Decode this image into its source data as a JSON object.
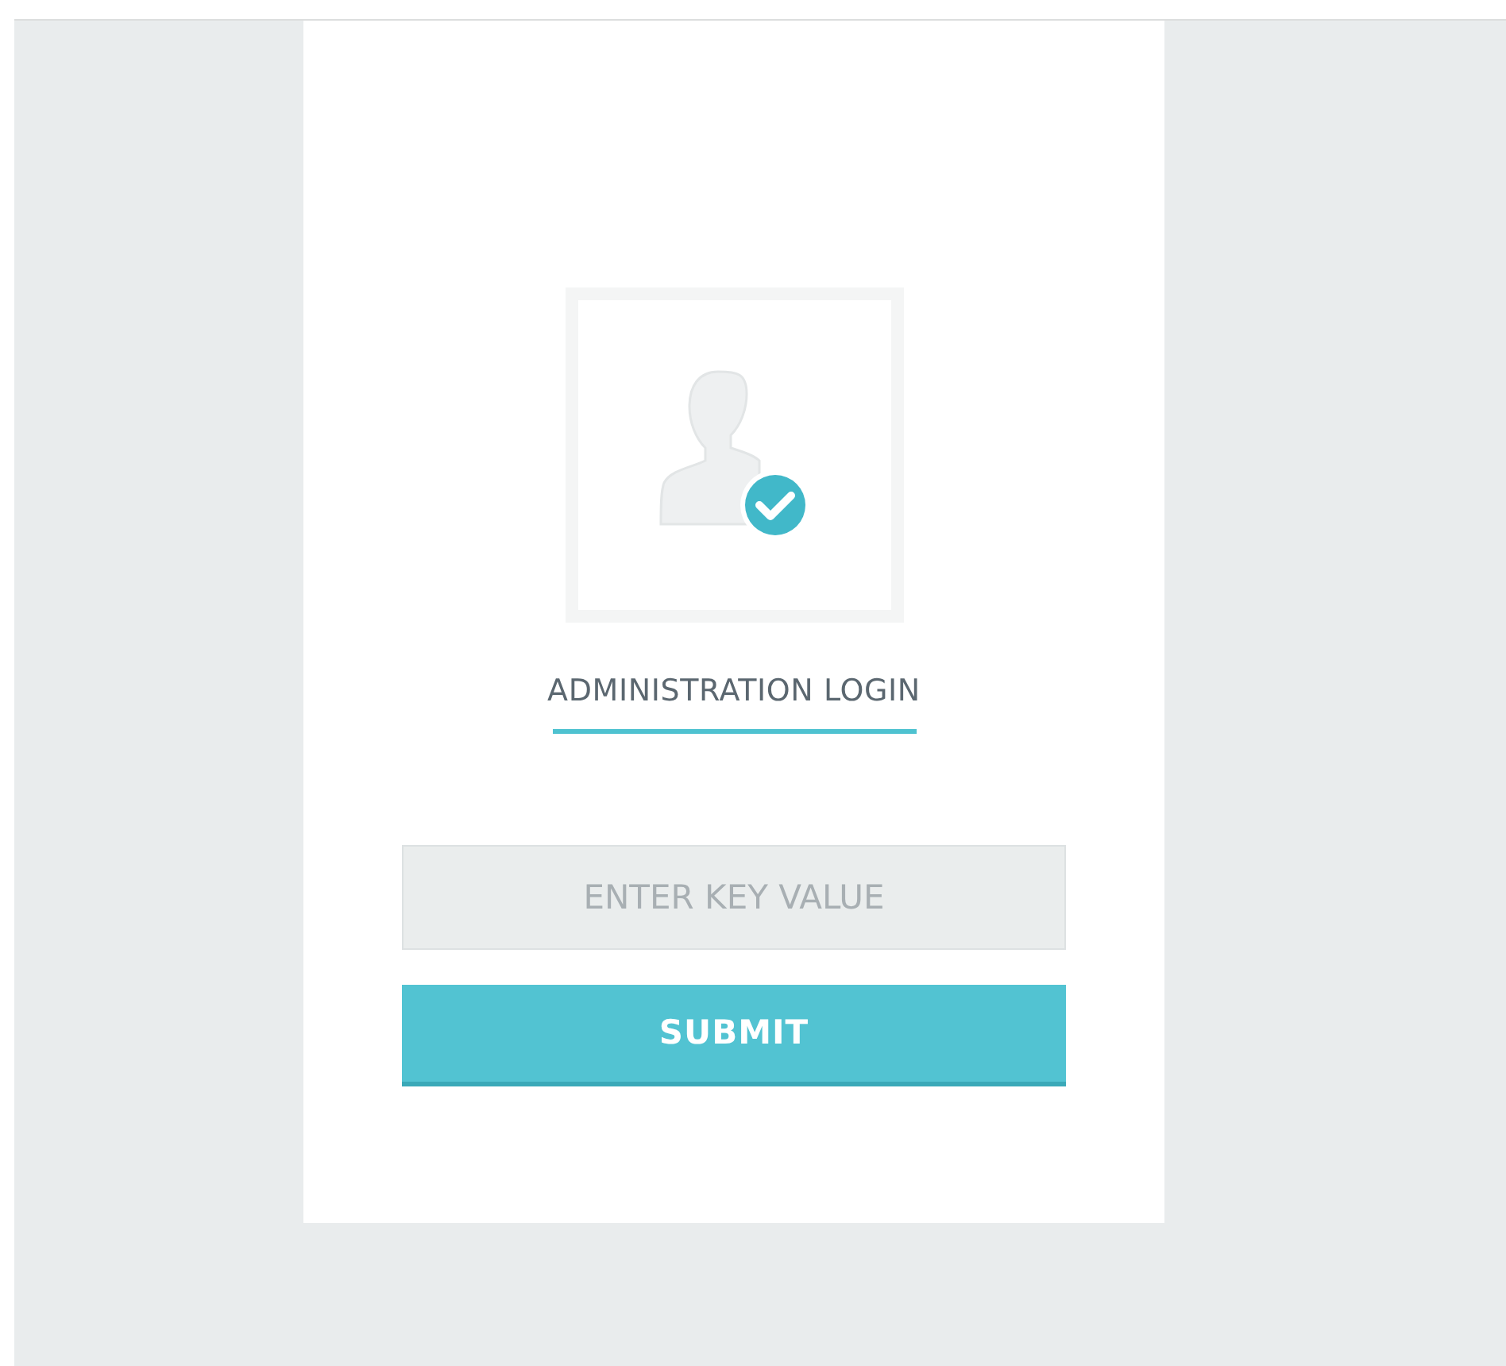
{
  "login": {
    "title": "ADMINISTRATION LOGIN",
    "key_field": {
      "placeholder": "ENTER KEY VALUE"
    },
    "submit_button": {
      "label": "SUBMIT"
    }
  }
}
